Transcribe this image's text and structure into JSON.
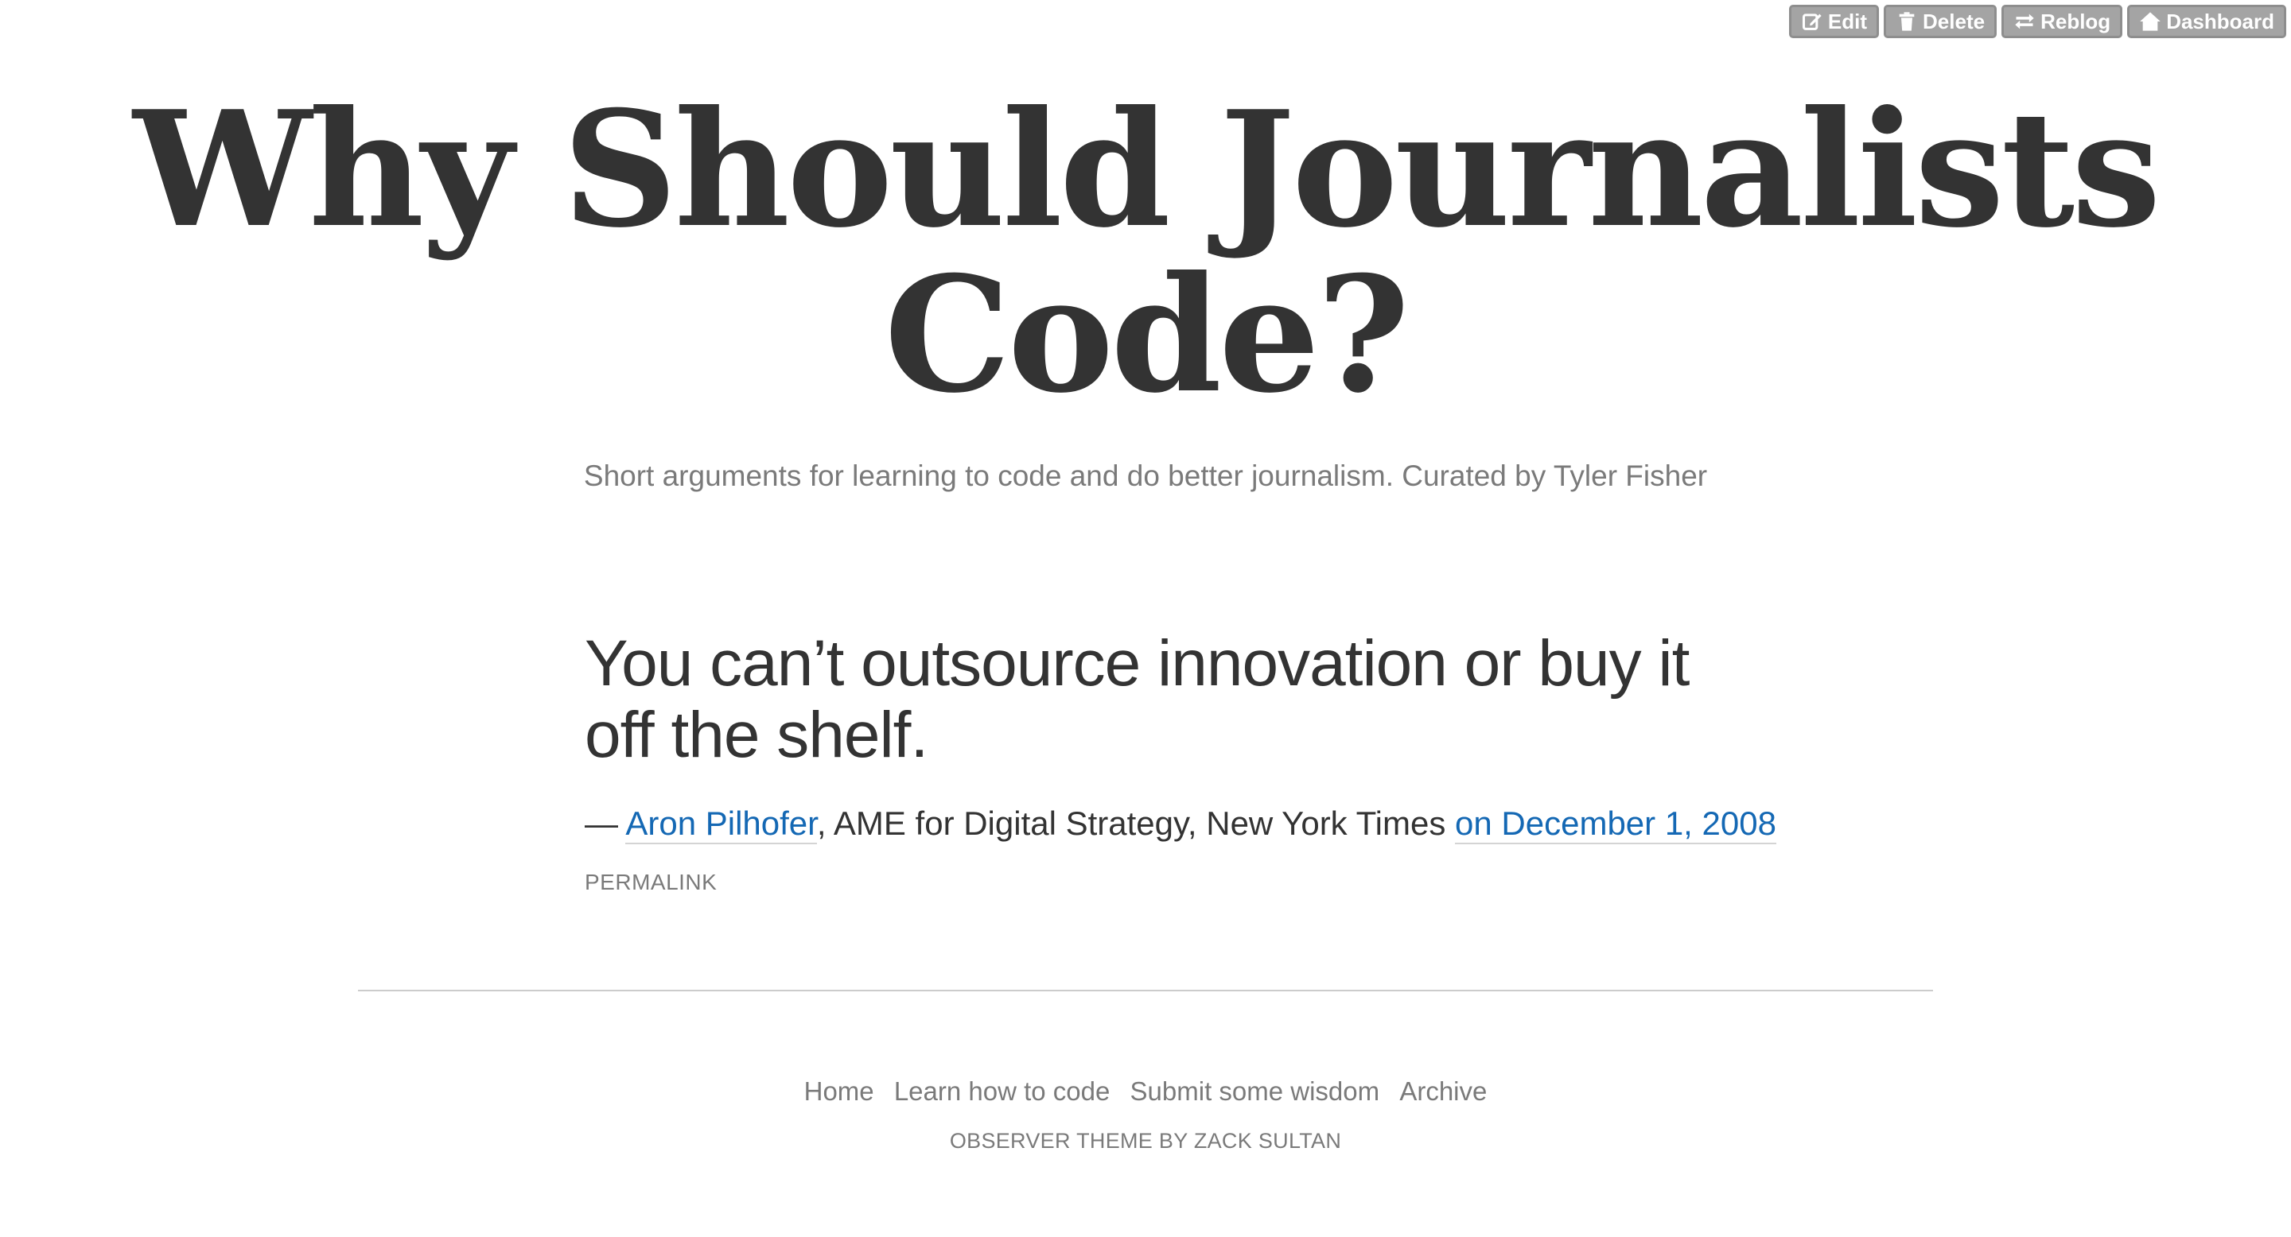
{
  "controls": {
    "edit_label": "Edit",
    "delete_label": "Delete",
    "reblog_label": "Reblog",
    "dashboard_label": "Dashboard"
  },
  "header": {
    "title": "Why Should Journalists Code?",
    "description": "Short arguments for learning to code and do better journalism. Curated by Tyler Fisher"
  },
  "post": {
    "quote": "You can’t outsource innovation or buy it off the shelf.",
    "dash": "— ",
    "author_link": "Aron Pilhofer",
    "author_role": ", AME for Digital Strategy, New York Times ",
    "date_link": "on December 1, 2008",
    "permalink": "PERMALINK"
  },
  "footer": {
    "nav": [
      "Home",
      "Learn how to code",
      "Submit some wisdom",
      "Archive"
    ],
    "credit": "OBSERVER THEME BY ZACK SULTAN"
  },
  "colors": {
    "text": "#333333",
    "muted": "#7a7a7a",
    "link": "#1468b4",
    "control_bg": "#a4a4a4"
  }
}
